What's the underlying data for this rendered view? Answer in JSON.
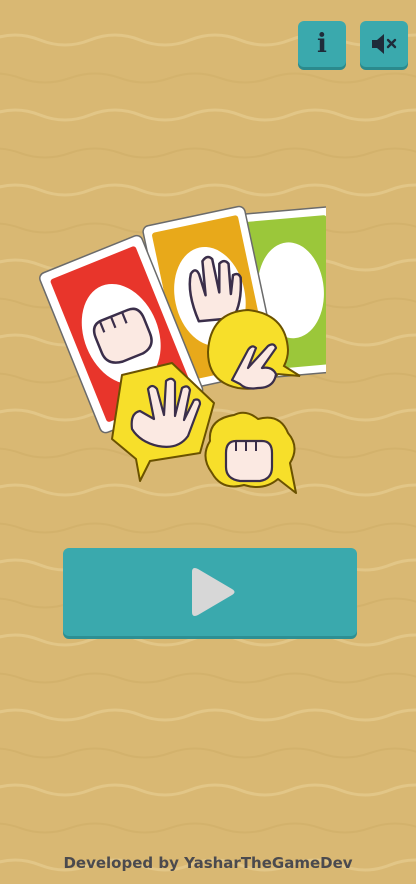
{
  "background": {
    "color": "#d9b873",
    "pattern": "wavy-lines"
  },
  "header": {
    "info_button": {
      "label": "i",
      "icon": "info-icon"
    },
    "sound_button": {
      "icon": "speaker-muted-icon"
    }
  },
  "logo": {
    "cards": [
      "red-card-rock",
      "yellow-card-paper",
      "green-card-scissors"
    ],
    "bubbles": [
      "paper-hand-bubble",
      "scissors-hand-bubble",
      "rock-hand-bubble"
    ]
  },
  "play_button": {
    "icon": "play-icon"
  },
  "footer": {
    "credit": "Developed by YasharTheGameDev"
  },
  "colors": {
    "accent": "#3aa9ad",
    "accent_shadow": "#2d8f93",
    "icon_dark": "#1f2b3a",
    "card_red": "#e8352b",
    "card_yellow": "#e8a91a",
    "card_green": "#9bc73a",
    "bubble_yellow": "#f7df2a",
    "play_icon": "#d7d7d7"
  }
}
